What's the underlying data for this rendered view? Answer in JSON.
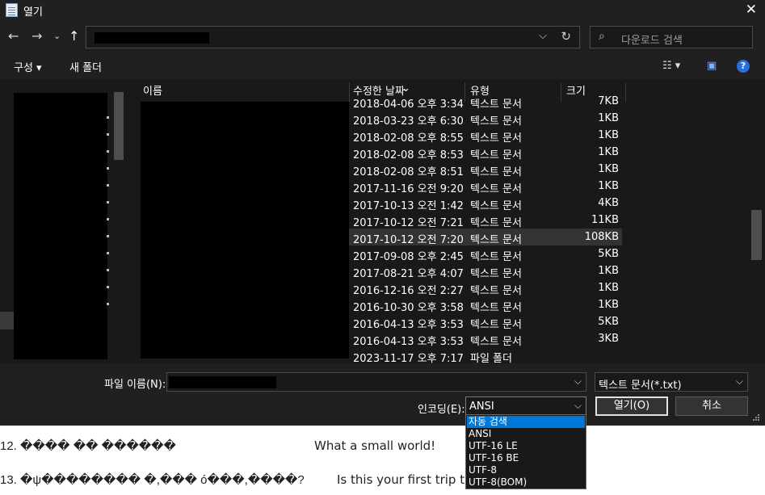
{
  "dialog": {
    "title": "열기",
    "close_glyph": "✕"
  },
  "nav": {
    "back": "←",
    "forward": "→",
    "recent": "⌄",
    "up": "↑",
    "addr_chevron": "⌵",
    "refresh": "↻",
    "search_icon": "⌕",
    "search_placeholder": "다운로드 검색"
  },
  "toolbar": {
    "organize_label": "구성 ▾",
    "new_folder_label": "새 폴더",
    "view_glyph": "☷ ▾",
    "preview_glyph": "▣",
    "help_glyph": "?"
  },
  "columns": {
    "name": "이름",
    "modified": "수정한 날짜",
    "type": "유형",
    "size": "크기"
  },
  "files": [
    {
      "date": "2018-04-06 오후 3:34",
      "type": "텍스트 문서",
      "size": "7KB"
    },
    {
      "date": "2018-03-23 오후 6:30",
      "type": "텍스트 문서",
      "size": "1KB"
    },
    {
      "date": "2018-02-08 오후 8:55",
      "type": "텍스트 문서",
      "size": "1KB"
    },
    {
      "date": "2018-02-08 오후 8:53",
      "type": "텍스트 문서",
      "size": "1KB"
    },
    {
      "date": "2018-02-08 오후 8:51",
      "type": "텍스트 문서",
      "size": "1KB"
    },
    {
      "date": "2017-11-16 오전 9:20",
      "type": "텍스트 문서",
      "size": "1KB"
    },
    {
      "date": "2017-10-13 오전 1:42",
      "type": "텍스트 문서",
      "size": "4KB"
    },
    {
      "date": "2017-10-12 오전 7:21",
      "type": "텍스트 문서",
      "size": "11KB"
    },
    {
      "date": "2017-10-12 오전 7:20",
      "type": "텍스트 문서",
      "size": "108KB",
      "selected": true
    },
    {
      "date": "2017-09-08 오후 2:45",
      "type": "텍스트 문서",
      "size": "5KB"
    },
    {
      "date": "2017-08-21 오후 4:07",
      "type": "텍스트 문서",
      "size": "1KB"
    },
    {
      "date": "2016-12-16 오전 2:27",
      "type": "텍스트 문서",
      "size": "1KB"
    },
    {
      "date": "2016-10-30 오후 3:58",
      "type": "텍스트 문서",
      "size": "1KB"
    },
    {
      "date": "2016-04-13 오후 3:53",
      "type": "텍스트 문서",
      "size": "5KB"
    },
    {
      "date": "2016-04-13 오후 3:53",
      "type": "텍스트 문서",
      "size": "3KB"
    },
    {
      "date": "2023-11-17 오후 7:17",
      "type": "파일 폴더",
      "size": ""
    }
  ],
  "bottom": {
    "filename_label": "파일 이름(N):",
    "filetype_value": "텍스트 문서(*.txt)",
    "encoding_label": "인코딩(E):",
    "encoding_value": "ANSI",
    "open_label": "열기(O)",
    "cancel_label": "취소",
    "combo_arrow": "⌵"
  },
  "encoding_options": [
    "자동 검색",
    "ANSI",
    "UTF-16 LE",
    "UTF-16 BE",
    "UTF-8",
    "UTF-8(BOM)"
  ],
  "background_doc": {
    "line12_num": "12. ���� �� ������",
    "line12_en": "What a small world!",
    "line13_num": "13. �ψ�������� �,��� ó���,����?",
    "line13_en": "Is this your first trip t"
  },
  "colors": {
    "dialog_bg": "#202020",
    "pane_bg": "#191919",
    "selection": "#0078d7",
    "help_blue": "#2a6fdc"
  }
}
